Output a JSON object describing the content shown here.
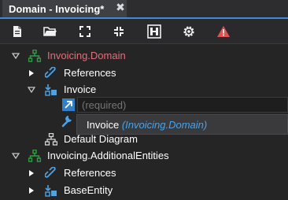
{
  "tab": {
    "title": "Domain - Invoicing*",
    "close_glyph": "✖"
  },
  "toolbar": {
    "buttons": [
      {
        "icon": "new-document-icon"
      },
      {
        "icon": "open-folder-icon"
      },
      {
        "icon": "expand-all-icon"
      },
      {
        "icon": "collapse-all-icon"
      },
      {
        "icon": "diagram-view-icon"
      },
      {
        "icon": "settings-gear-icon"
      },
      {
        "icon": "error-warning-icon"
      }
    ]
  },
  "tree": {
    "root1": {
      "label": "Invoicing.Domain",
      "color": "#e0707a"
    },
    "references1": {
      "label": "References"
    },
    "invoice": {
      "label": "Invoice"
    },
    "default_diagram": {
      "label": "Default Diagram"
    },
    "root2": {
      "label": "Invoicing.AdditionalEntities"
    },
    "references2": {
      "label": "References"
    },
    "base_entity": {
      "label": "BaseEntity"
    }
  },
  "editor": {
    "placeholder": "(required)"
  },
  "dropdown": {
    "selected_name": "Invoice",
    "selected_package": "(Invoicing.Domain)"
  },
  "colors": {
    "accent": "#3d8ad8",
    "package_green": "#2ea043",
    "link_blue": "#4aa3e8",
    "warning_red": "#e05252"
  }
}
